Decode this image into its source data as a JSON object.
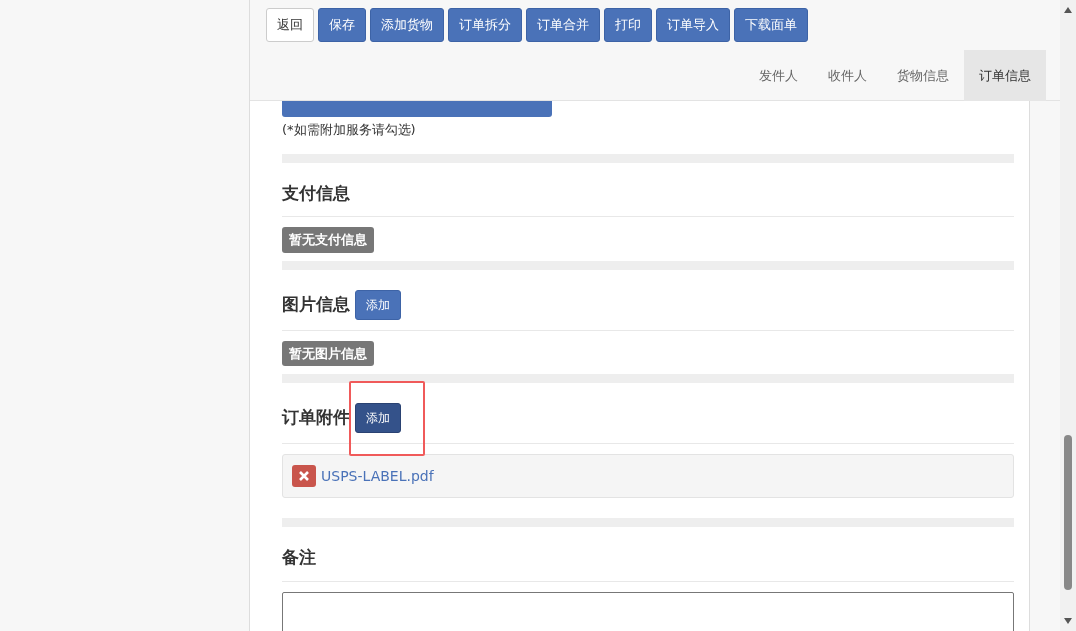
{
  "toolbar": {
    "buttons": [
      {
        "label": "返回",
        "kind": "default"
      },
      {
        "label": "保存",
        "kind": "primary"
      },
      {
        "label": "添加货物",
        "kind": "primary"
      },
      {
        "label": "订单拆分",
        "kind": "primary"
      },
      {
        "label": "订单合并",
        "kind": "primary"
      },
      {
        "label": "打印",
        "kind": "primary"
      },
      {
        "label": "订单导入",
        "kind": "primary"
      },
      {
        "label": "下载面单",
        "kind": "primary"
      }
    ]
  },
  "tabs": [
    {
      "label": "发件人",
      "selected": false
    },
    {
      "label": "收件人",
      "selected": false
    },
    {
      "label": "货物信息",
      "selected": false
    },
    {
      "label": "订单信息",
      "selected": true
    }
  ],
  "service_note": "(*如需附加服务请勾选)",
  "sections": [
    {
      "title": "支付信息",
      "kind": "badge",
      "empty_text": "暂无支付信息"
    },
    {
      "title": "图片信息",
      "kind": "badge",
      "add_button": {
        "label": "添加",
        "highlighted": false
      },
      "empty_text": "暂无图片信息"
    },
    {
      "title": "订单附件",
      "kind": "files",
      "add_button": {
        "label": "添加",
        "highlighted": true
      },
      "files": [
        {
          "name": "USPS-LABEL.pdf"
        }
      ]
    },
    {
      "title": "备注",
      "kind": "textarea"
    }
  ]
}
